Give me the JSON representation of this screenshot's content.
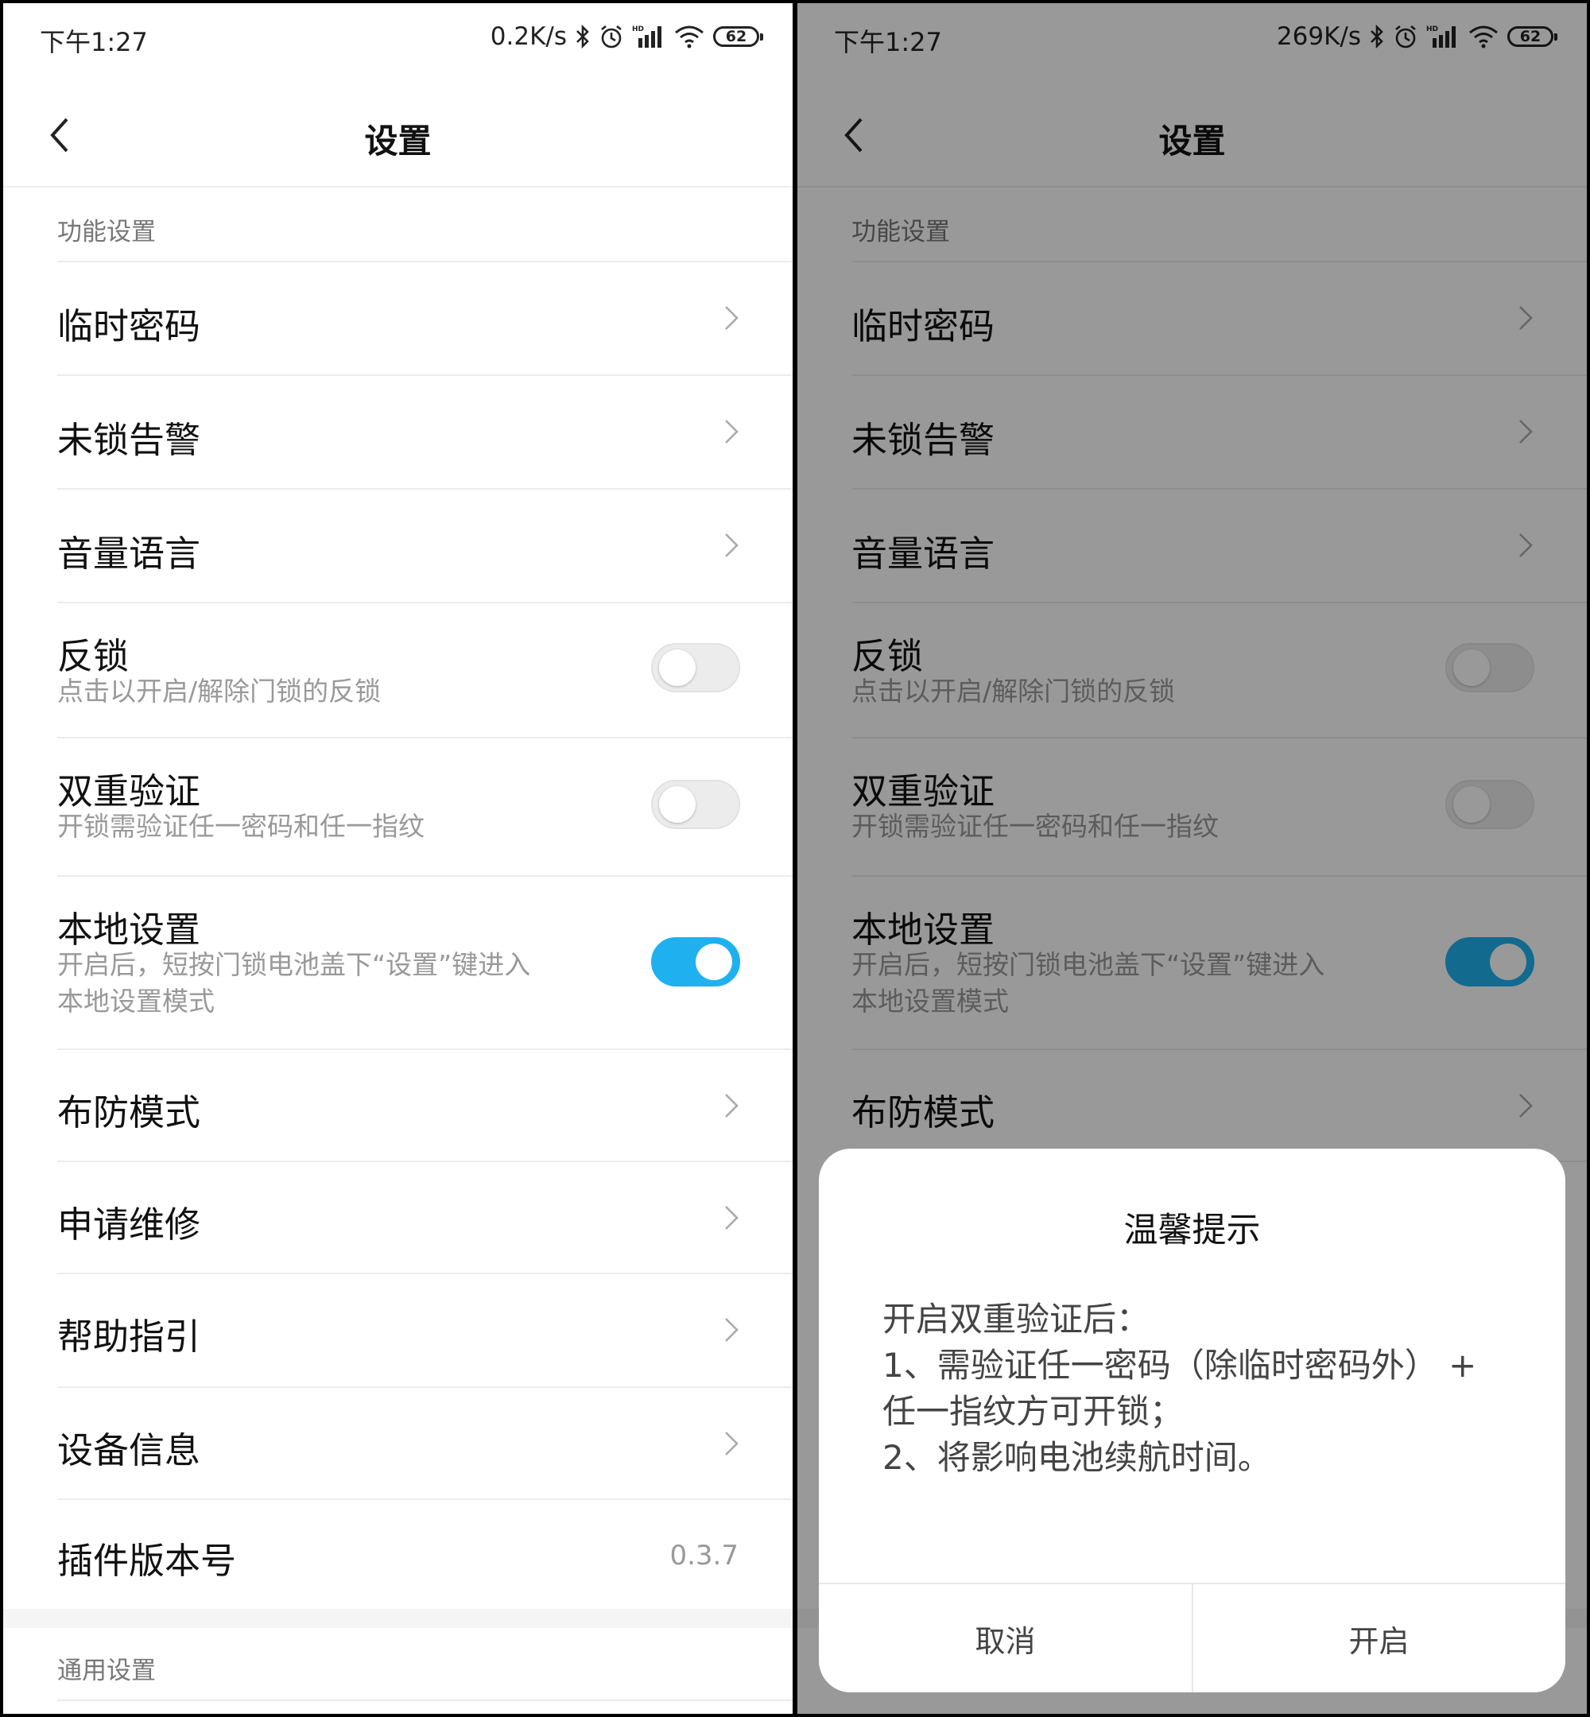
{
  "screens": [
    {
      "status": {
        "time": "下午1:27",
        "speed": "0.2K/s",
        "battery": "62"
      }
    },
    {
      "status": {
        "time": "下午1:27",
        "speed": "269K/s",
        "battery": "62"
      }
    }
  ],
  "header": {
    "title": "设置"
  },
  "sections": {
    "function": "功能设置",
    "general": "通用设置"
  },
  "rows": {
    "temp_password": {
      "title": "临时密码"
    },
    "unlock_alert": {
      "title": "未锁告警"
    },
    "volume_language": {
      "title": "音量语言"
    },
    "anti_lock": {
      "title": "反锁",
      "subtitle": "点击以开启/解除门锁的反锁",
      "on": false
    },
    "double_verify": {
      "title": "双重验证",
      "subtitle": "开锁需验证任一密码和任一指纹",
      "on": false
    },
    "local_settings": {
      "title": "本地设置",
      "subtitle": "开启后，短按门锁电池盖下“设置”键进入本地设置模式",
      "on": true
    },
    "arming_mode": {
      "title": "布防模式"
    },
    "repair_request": {
      "title": "申请维修"
    },
    "help_guide": {
      "title": "帮助指引"
    },
    "device_info": {
      "title": "设备信息"
    },
    "plugin_version": {
      "title": "插件版本号",
      "value": "0.3.7"
    }
  },
  "dialog": {
    "title": "温馨提示",
    "lines": [
      "开启双重验证后：",
      "1、需验证任一密码（除临时密码外） +",
      "任一指纹方可开锁；",
      "2、将影响电池续航时间。"
    ],
    "cancel": "取消",
    "confirm": "开启"
  },
  "colors": {
    "accent": "#1fb1ef",
    "divider": "#ececec"
  },
  "icons": [
    "back-arrow-icon",
    "chevron-right-icon",
    "bluetooth-icon",
    "alarm-icon",
    "signal-icon",
    "wifi-icon",
    "battery-icon"
  ]
}
